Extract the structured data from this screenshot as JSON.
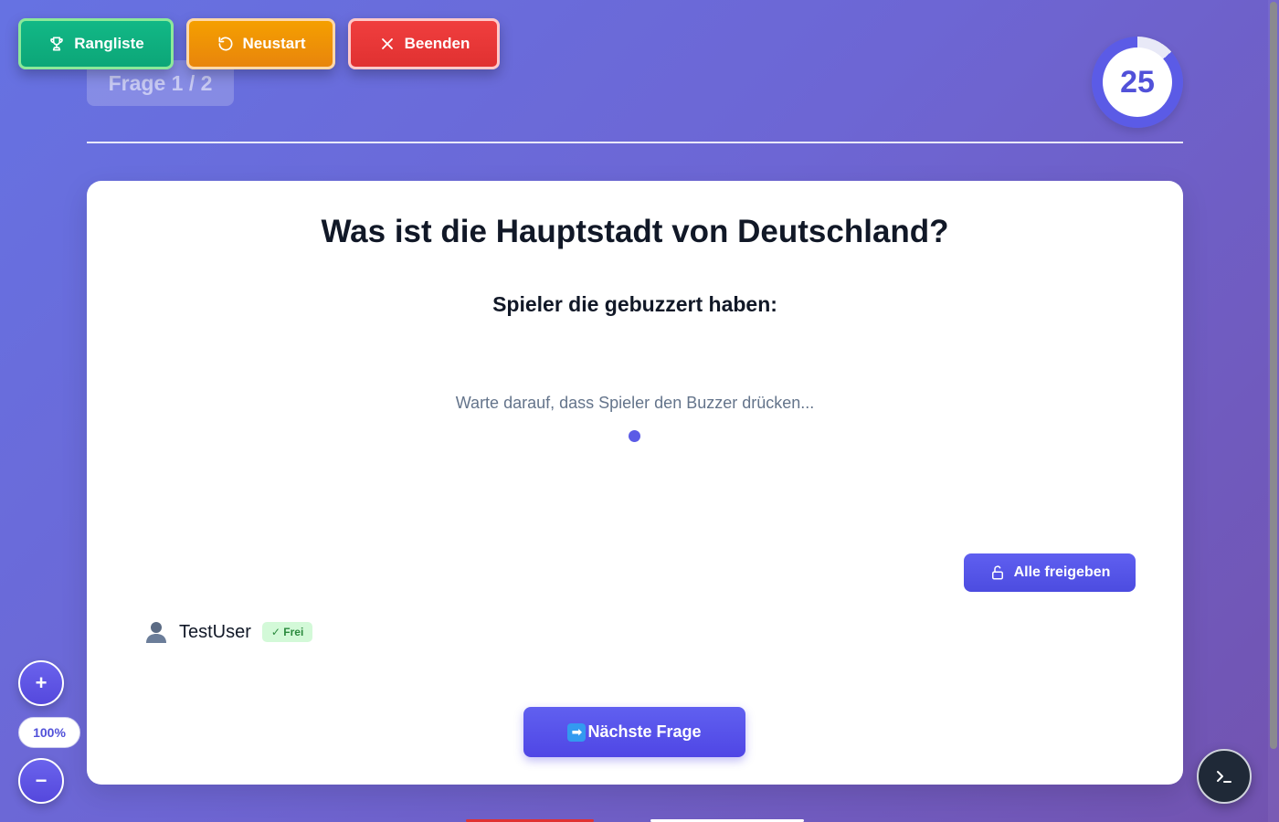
{
  "header": {
    "buttons": {
      "leaderboard_label": "Rangliste",
      "restart_label": "Neustart",
      "quit_label": "Beenden"
    },
    "question_counter": "Frage 1 / 2",
    "timer_value": "25"
  },
  "main": {
    "question": "Was ist die Hauptstadt von Deutschland?",
    "buzzed_title": "Spieler die gebuzzert haben:",
    "waiting_text": "Warte darauf, dass Spieler den Buzzer drücken...",
    "release_all_label": "Alle freigeben",
    "players": [
      {
        "name": "TestUser",
        "status": "✓ Frei"
      }
    ],
    "next_question_label": "Nächste Frage",
    "next_question_icon": "➡"
  },
  "zoom": {
    "plus_label": "+",
    "level": "100%",
    "minus_label": "−"
  },
  "icons": {
    "leaderboard": "trophy-icon",
    "restart": "rotate-ccw-icon",
    "quit": "close-icon",
    "release": "unlock-icon",
    "player": "user-icon",
    "terminal": "terminal-icon"
  },
  "colors": {
    "accent": "#5b5be6",
    "leaderboard": "#0ca678",
    "restart": "#f59f00",
    "quit": "#e03131",
    "status_free": "#2b8a3e"
  }
}
